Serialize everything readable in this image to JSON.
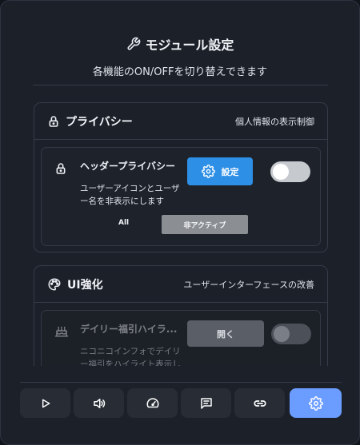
{
  "header": {
    "title": "モジュール設定",
    "subtitle": "各機能のON/OFFを切り替えできます",
    "icon": "wrench-icon"
  },
  "sections": [
    {
      "title": "プライバシー",
      "description": "個人情報の表示制御",
      "icon": "lock-icon",
      "cards": [
        {
          "title": "ヘッダープライバシー",
          "description": "ユーザーアイコンとユーザー名を非表示にします",
          "button_label": "設定",
          "toggle_on": false,
          "status_label": "All",
          "status_value": "非アクティブ"
        }
      ]
    },
    {
      "title": "UI強化",
      "description": "ユーザーインターフェースの改善",
      "icon": "palette-icon",
      "cards": [
        {
          "title": "デイリー福引ハイラ...",
          "description": "ニコニコインフォでデイリー福引をハイライト表示しま",
          "button_label": "開く",
          "toggle_on": false
        }
      ]
    }
  ],
  "toolbar": {
    "items": [
      {
        "icon": "play-icon",
        "active": false
      },
      {
        "icon": "volume-icon",
        "active": false
      },
      {
        "icon": "speedometer-icon",
        "active": false
      },
      {
        "icon": "comment-icon",
        "active": false
      },
      {
        "icon": "link-icon",
        "active": false
      },
      {
        "icon": "gear-icon",
        "active": true
      }
    ]
  },
  "colors": {
    "accent": "#2d8fe6",
    "active_tab": "#6b9cff",
    "background": "#1b2029"
  }
}
